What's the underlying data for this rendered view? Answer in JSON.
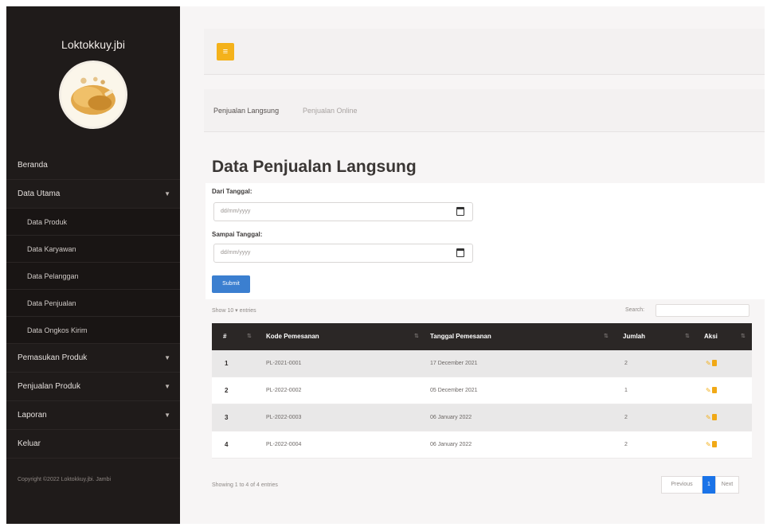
{
  "sidebar": {
    "brand": "Loktokkuy.jbi",
    "items": [
      {
        "label": "Beranda",
        "caret": ""
      },
      {
        "label": "Data Utama",
        "caret": "▼"
      },
      {
        "label": "Data Produk",
        "caret": ""
      },
      {
        "label": "Data Karyawan",
        "caret": ""
      },
      {
        "label": "Data Pelanggan",
        "caret": ""
      },
      {
        "label": "Data Penjualan",
        "caret": ""
      },
      {
        "label": "Data Ongkos Kirim",
        "caret": ""
      },
      {
        "label": "Pemasukan Produk",
        "caret": "▼"
      },
      {
        "label": "Penjualan Produk",
        "caret": "▼"
      },
      {
        "label": "Laporan",
        "caret": "▼"
      },
      {
        "label": "Keluar",
        "caret": ""
      }
    ],
    "copyright": "Copyright ©2022 Loktokkuy.jbi. Jambi"
  },
  "topbar": {
    "toggle_icon": "≡"
  },
  "breadcrumb": {
    "item1": "Penjualan Langsung",
    "item2": "Penjualan Online"
  },
  "page_title": "Data Penjualan Langsung",
  "form": {
    "from_label": "Dari Tanggal:",
    "from_placeholder": "dd/mm/yyyy",
    "to_label": "Sampai Tanggal:",
    "to_placeholder": "dd/mm/yyyy",
    "submit_label": "Submit"
  },
  "table_tools": {
    "show_text": "Show 10 ▾ entries",
    "search_label": "Search:"
  },
  "table": {
    "headers": {
      "no": "#",
      "kode": "Kode Pemesanan",
      "tanggal": "Tanggal Pemesanan",
      "jumlah": "Jumlah",
      "aksi": "Aksi"
    },
    "rows": [
      {
        "no": "1",
        "kode": "PL-2021-0001",
        "tanggal": "17 December 2021",
        "jumlah": "2"
      },
      {
        "no": "2",
        "kode": "PL-2022-0002",
        "tanggal": "05 December 2021",
        "jumlah": "1"
      },
      {
        "no": "3",
        "kode": "PL-2022-0003",
        "tanggal": "06 January 2022",
        "jumlah": "2"
      },
      {
        "no": "4",
        "kode": "PL-2022-0004",
        "tanggal": "06 January 2022",
        "jumlah": "2"
      }
    ],
    "action_edit_icon": "✎"
  },
  "footer": {
    "info": "Showing 1 to 4 of 4 entries",
    "prev": "Previous",
    "page": "1",
    "next": "Next"
  },
  "colors": {
    "sidebar_bg": "#1f1b1a",
    "accent_yellow": "#f4b21b",
    "submit_blue": "#3b7fd0",
    "table_header": "#2b2726",
    "pager_active": "#1a73e8"
  }
}
